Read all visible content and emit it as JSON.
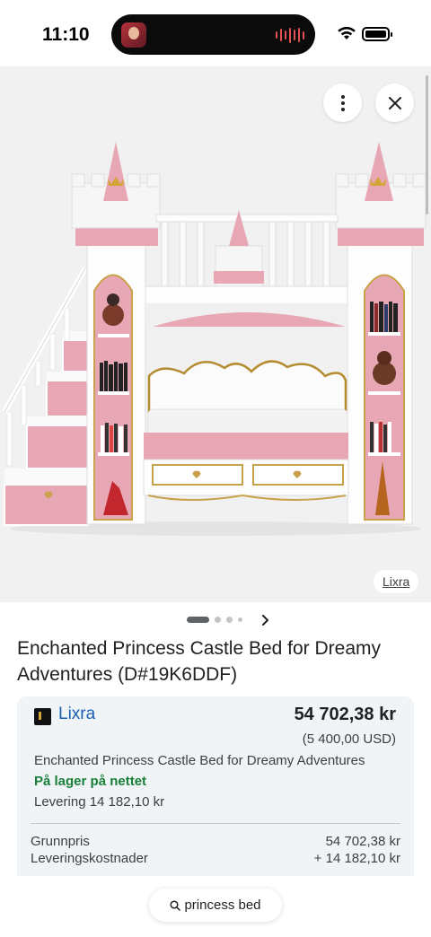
{
  "status_bar": {
    "time": "11:10"
  },
  "image_viewer": {
    "source_label": "Lixra",
    "more_icon": "more-vertical-icon",
    "close_icon": "close-icon",
    "pager": {
      "total_pages": 4,
      "current_page": 1,
      "next_icon": "chevron-right-icon"
    }
  },
  "product": {
    "title": "Enchanted Princess Castle Bed for Dreamy Adventures (D#19K6DDF)"
  },
  "offer": {
    "store_name": "Lixra",
    "price": "54 702,38 kr",
    "price_converted": "(5 400,00 USD)",
    "description": "Enchanted Princess Castle Bed for Dreamy Adventures",
    "stock_status": "På lager på nettet",
    "delivery": "Levering 14 182,10 kr",
    "breakdown": [
      {
        "label": "Grunnpris",
        "value": "54 702,38 kr"
      },
      {
        "label": "Leveringskostnader",
        "value": "+ 14 182,10 kr"
      }
    ]
  },
  "search_chip": {
    "query": "princess bed",
    "icon": "search-icon"
  },
  "colors": {
    "link": "#1a5fb4",
    "in_stock": "#188038",
    "bed_pink": "#e8a7b4"
  }
}
